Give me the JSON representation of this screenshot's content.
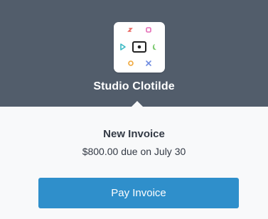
{
  "business": {
    "name": "Studio Clotilde",
    "logo_icon": "studio-clotilde-logo-icon"
  },
  "invoice": {
    "title": "New Invoice",
    "due_text": "$800.00 due on July 30"
  },
  "actions": {
    "pay_label": "Pay Invoice"
  },
  "colors": {
    "header_bg": "#525d6b",
    "card_bg": "#f8f9fa",
    "button_bg": "#2f8fcb",
    "text": "#333a45"
  }
}
